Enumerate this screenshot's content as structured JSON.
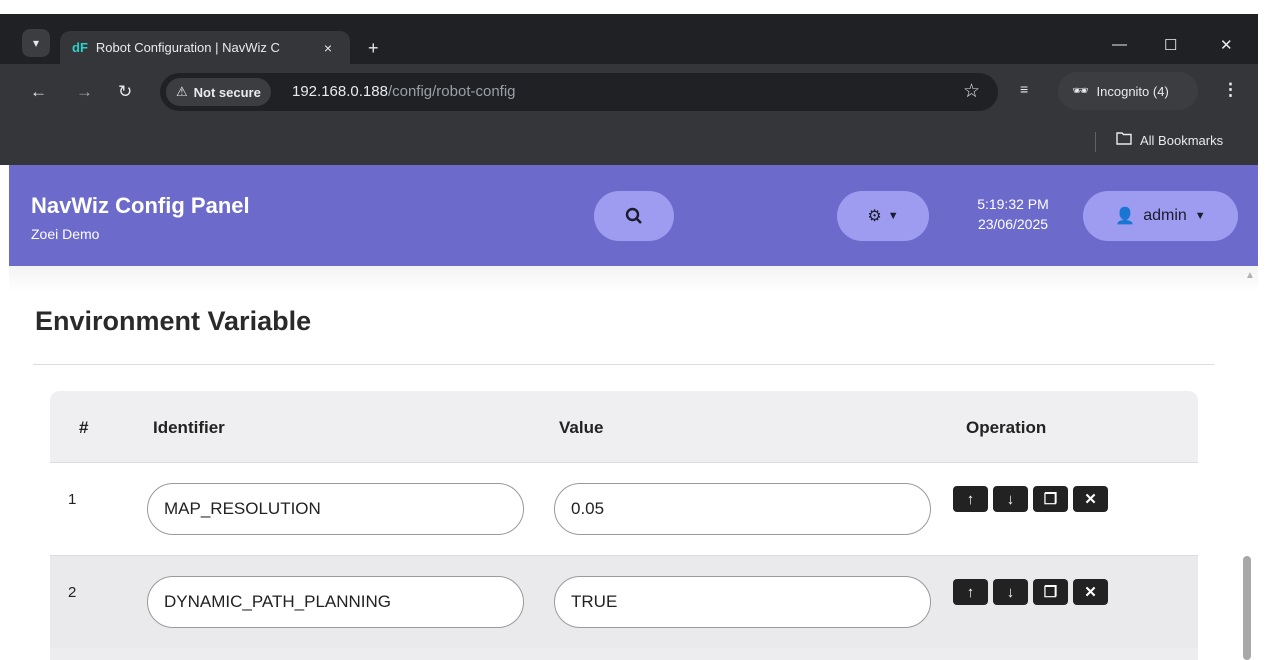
{
  "browser": {
    "tab_title": "Robot Configuration | NavWiz C",
    "tab_favicon": "navwiz-logo-icon",
    "new_tab": "+",
    "close_tab": "×",
    "security_label": "Not secure",
    "url_host": "192.168.0.188",
    "url_path": "/config/robot-config",
    "incognito_label": "Incognito (4)",
    "bookmarks_label": "All Bookmarks",
    "window_controls": [
      "—",
      "☐",
      "✕"
    ]
  },
  "header": {
    "title": "NavWiz Config Panel",
    "subtitle": "Zoei Demo",
    "time": "5:19:32 PM",
    "date": "23/06/2025",
    "user": "admin",
    "color": "#6c6acb",
    "button_color": "#9d9cf0"
  },
  "section": {
    "title": "Environment Variable"
  },
  "table": {
    "headers": [
      "#",
      "Identifier",
      "Value",
      "Operation"
    ],
    "rows": [
      {
        "num": "1",
        "identifier": "MAP_RESOLUTION",
        "value": "0.05"
      },
      {
        "num": "2",
        "identifier": "DYNAMIC_PATH_PLANNING",
        "value": "TRUE"
      }
    ],
    "operations": [
      "move-up-icon",
      "move-down-icon",
      "copy-icon",
      "delete-icon"
    ]
  }
}
